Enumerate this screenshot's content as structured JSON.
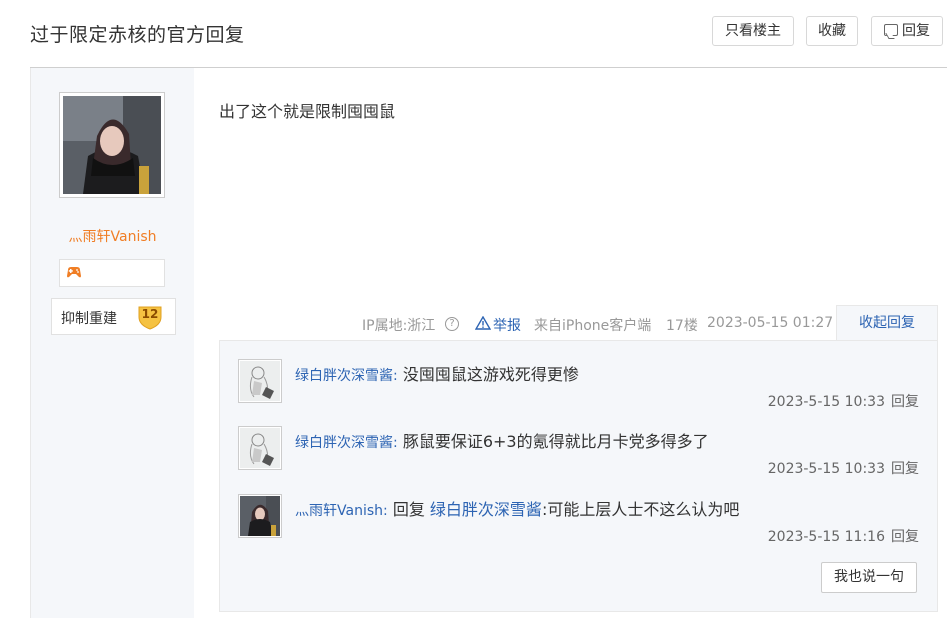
{
  "thread": {
    "title": "过于限定赤核的官方回复"
  },
  "toolbar": {
    "only_op_label": "只看楼主",
    "favorite_label": "收藏",
    "reply_label": "回复"
  },
  "author": {
    "name": "灬雨轩Vanish",
    "level_name": "抑制重建",
    "level_number": "12",
    "level_color": "#f5c242"
  },
  "post": {
    "content": "出了这个就是限制囤囤鼠",
    "meta": {
      "ip_location": "IP属地:浙江",
      "report_label": "举报",
      "client": "来自iPhone客户端",
      "floor": "17楼",
      "datetime": "2023-05-15 01:27"
    },
    "collapse_label": "收起回复"
  },
  "replies": [
    {
      "user": "绿白胖次深雪酱:",
      "reply_word": "",
      "target": "",
      "text": "没囤囤鼠这游戏死得更惨",
      "datetime": "2023-5-15 10:33",
      "reply_label": "回复",
      "avatar": "anime-girl-sketch-avatar"
    },
    {
      "user": "绿白胖次深雪酱:",
      "reply_word": "",
      "target": "",
      "text": "豚鼠要保证6+3的氪得就比月卡党多得多了",
      "datetime": "2023-5-15 10:33",
      "reply_label": "回复",
      "avatar": "anime-girl-sketch-avatar"
    },
    {
      "user": "灬雨轩Vanish:",
      "reply_word": "回复",
      "target": "绿白胖次深雪酱",
      "text": ":可能上层人士不这么认为吧",
      "datetime": "2023-5-15 11:16",
      "reply_label": "回复",
      "avatar": "photo-girl-avatar"
    }
  ],
  "compose": {
    "say_label": "我也说一句"
  },
  "colors": {
    "link_blue": "#2d64b3",
    "author_orange": "#f07e25",
    "panel_bg": "#f5f7fa"
  }
}
